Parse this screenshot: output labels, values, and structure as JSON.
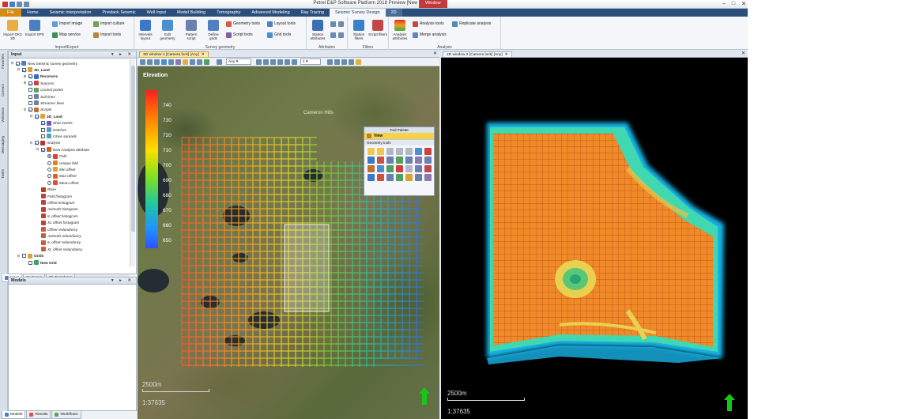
{
  "app": {
    "title": "Petrel E&P Software Platform 2018 Preview [New project]",
    "window_tab": "Window"
  },
  "ribbon_tabs": [
    "File",
    "Home",
    "Seismic interpretation",
    "Prestack Seismic",
    "Well Input",
    "Model Building",
    "Tomography",
    "Advanced Modeling",
    "Ray Tracing",
    "Seismic Survey Design",
    "2D"
  ],
  "ribbon": {
    "groups": [
      {
        "label": "Import/Export"
      },
      {
        "label": "Survey geometry"
      },
      {
        "label": "Attributes"
      },
      {
        "label": "Filters"
      },
      {
        "label": "Analysis"
      }
    ],
    "import_ok_label": "Import OK3 2D",
    "export_label": "Export SPS",
    "import_image": "Import image",
    "import_culture": "Import culture",
    "map_service": "Map service",
    "import_tools": "Import tools",
    "intervals_layout": "Intervals layout",
    "edit_geometry": "Edit geometry",
    "pattern_script": "Pattern script",
    "define_grids": "Define grids",
    "geometry_tools": "Geometry tools",
    "layout_tools": "Layout tools",
    "script_tools": "Script tools",
    "grid_tools": "Grid tools",
    "station_attributes": "Station attributes",
    "station_filters": "Station filters",
    "script_filters": "Script filters",
    "analysis_attributes": "Analysis attributes",
    "analysis_tools": "Analysis tools",
    "replicate_analysis": "Replicate analysis",
    "merge_analysis": "Merge analysis"
  },
  "side_strip": [
    "Favorites",
    "Cursors",
    "Windows",
    "Messaging",
    "Tasks"
  ],
  "input_panel": {
    "title": "Input",
    "tree": [
      {
        "level": 0,
        "exp": "-",
        "check": true,
        "label": "New Seismic survey geometry",
        "style": "",
        "icon": "#4a7fc1"
      },
      {
        "level": 1,
        "exp": "-",
        "check": true,
        "label": "3D_Land",
        "style": "b",
        "icon": "#e0a030"
      },
      {
        "level": 2,
        "exp": "+",
        "check": true,
        "label": "Receivers",
        "style": "b",
        "icon": "#3070d0"
      },
      {
        "level": 2,
        "exp": "+",
        "check": true,
        "label": "Sources",
        "style": "i",
        "icon": "#d04040"
      },
      {
        "level": 2,
        "exp": "",
        "check": false,
        "label": "Control points",
        "style": "i",
        "icon": "#60a060"
      },
      {
        "level": 2,
        "exp": "",
        "check": false,
        "label": "Sail lines",
        "style": "i",
        "icon": "#7080a0"
      },
      {
        "level": 2,
        "exp": "",
        "check": false,
        "label": "Streamer lines",
        "style": "i",
        "icon": "#7080a0"
      },
      {
        "level": 2,
        "exp": "-",
        "check": true,
        "label": "Scripts",
        "style": "i",
        "icon": "#c07030"
      },
      {
        "level": 3,
        "exp": "-",
        "check": true,
        "label": "3D_Land",
        "style": "b",
        "icon": "#e0a030"
      },
      {
        "level": 4,
        "exp": "",
        "check": true,
        "label": "Shot events",
        "style": "i",
        "icon": "#8050c0"
      },
      {
        "level": 4,
        "exp": "",
        "check": false,
        "label": "Patches",
        "style": "i",
        "icon": "#50a0c0"
      },
      {
        "level": 4,
        "exp": "",
        "check": false,
        "label": "Close spreads",
        "style": "i",
        "icon": "#50a0c0"
      },
      {
        "level": 3,
        "exp": "-",
        "check": true,
        "label": "Analysis",
        "style": "i",
        "icon": "#c03030"
      },
      {
        "level": 4,
        "exp": "-",
        "check": true,
        "label": "New Analysis attribute",
        "style": "",
        "icon": "#d06020"
      },
      {
        "level": 5,
        "exp": "",
        "radio": true,
        "label": "Fold",
        "style": "i",
        "icon": "#e04030"
      },
      {
        "level": 5,
        "exp": "",
        "radio": false,
        "label": "Unique fold",
        "style": "i",
        "icon": "#e08030"
      },
      {
        "level": 5,
        "exp": "",
        "radio": false,
        "label": "Min offset",
        "style": "i",
        "icon": "#e0a030"
      },
      {
        "level": 5,
        "exp": "",
        "radio": false,
        "label": "Max offset",
        "style": "i",
        "icon": "#e06030"
      },
      {
        "level": 5,
        "exp": "",
        "radio": false,
        "label": "Mean offset",
        "style": "i",
        "icon": "#e05030"
      },
      {
        "level": 4,
        "exp": "",
        "label": "Rose",
        "style": "i",
        "icon": "#b04020"
      },
      {
        "level": 4,
        "exp": "",
        "label": "Fold histogram",
        "style": "i",
        "icon": "#c04040"
      },
      {
        "level": 4,
        "exp": "",
        "label": "Offset histogram",
        "style": "i",
        "icon": "#c04040"
      },
      {
        "level": 4,
        "exp": "",
        "label": "Azimuth histogram",
        "style": "i",
        "icon": "#c04040"
      },
      {
        "level": 4,
        "exp": "",
        "label": "IL offset histogram",
        "style": "i",
        "icon": "#c04040"
      },
      {
        "level": 4,
        "exp": "",
        "label": "XL offset histogram",
        "style": "i",
        "icon": "#c04040"
      },
      {
        "level": 4,
        "exp": "",
        "label": "Offset redundancy",
        "style": "i",
        "icon": "#c06040"
      },
      {
        "level": 4,
        "exp": "",
        "label": "Azimuth redundancy",
        "style": "i",
        "icon": "#c06040"
      },
      {
        "level": 4,
        "exp": "",
        "label": "IL offset redundancy",
        "style": "i",
        "icon": "#c06040"
      },
      {
        "level": 4,
        "exp": "",
        "label": "XL offset redundancy",
        "style": "i",
        "icon": "#c06040"
      },
      {
        "level": 1,
        "exp": "-",
        "check": false,
        "label": "Grids",
        "style": "b",
        "icon": "#e0a030"
      },
      {
        "level": 2,
        "exp": "",
        "check": false,
        "label": "New Grid",
        "style": "b",
        "icon": "#40a060"
      }
    ]
  },
  "panel_tabs_top": [
    "Input",
    "Cases",
    "Templates"
  ],
  "models_panel": {
    "title": "Models"
  },
  "panel_tabs_bottom": [
    "Models",
    "Results",
    "Workflows"
  ],
  "window1": {
    "tab": "3D window 1 [Camera lock] [Any]",
    "toolbar_combo": "Any",
    "toolbar_zoom": "1",
    "legend_title": "Elevation",
    "legend_ticks": [
      "740",
      "730",
      "720",
      "710",
      "700",
      "690",
      "680",
      "670",
      "660",
      "650"
    ],
    "map_label": "Cameron Hills",
    "scale_text": "2500m",
    "ratio_text": "1:37635"
  },
  "palette": {
    "title": "Tool Palette",
    "view": "View",
    "section": "Geometry tools"
  },
  "window2": {
    "tab": "2D window 2 [Camera lock] [Any]",
    "scale_text": "2500m",
    "ratio_text": "1:37635"
  },
  "colors": {
    "accent": "#d58a12",
    "ribbon_tab_bar": "#2b4e7a",
    "fold_fill": "#f08a28",
    "north_arrow": "#14c814"
  }
}
